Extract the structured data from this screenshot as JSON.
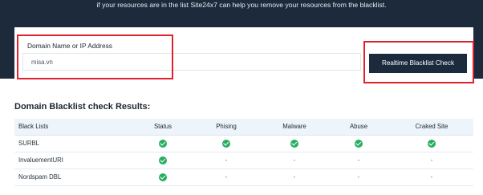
{
  "hero": {
    "text": "if your resources are in the list Site24x7 can help you remove your resources from the blacklist."
  },
  "form": {
    "label": "Domain Name or IP Address",
    "value": "misa.vn",
    "button_label": "Realtime Blacklist Check"
  },
  "annotations": {
    "highlight_color": "#e0212d"
  },
  "results": {
    "title": "Domain Blacklist check Results:",
    "columns": [
      "Black Lists",
      "Status",
      "Phising",
      "Malware",
      "Abuse",
      "Craked Site"
    ],
    "rows": [
      {
        "name": "SURBL",
        "status": "ok",
        "phising": "ok",
        "malware": "ok",
        "abuse": "ok",
        "craked_site": "ok"
      },
      {
        "name": "InvaluementURI",
        "status": "ok",
        "phising": "-",
        "malware": "-",
        "abuse": "-",
        "craked_site": "-"
      },
      {
        "name": "Nordspam DBL",
        "status": "ok",
        "phising": "-",
        "malware": "-",
        "abuse": "-",
        "craked_site": "-"
      }
    ],
    "ok_icon": "check-circle-icon",
    "ok_color": "#27ae60"
  },
  "colors": {
    "header_bg": "#1c2a3b",
    "button_bg": "#1b2a3d",
    "table_header_bg": "#eef4fb"
  }
}
